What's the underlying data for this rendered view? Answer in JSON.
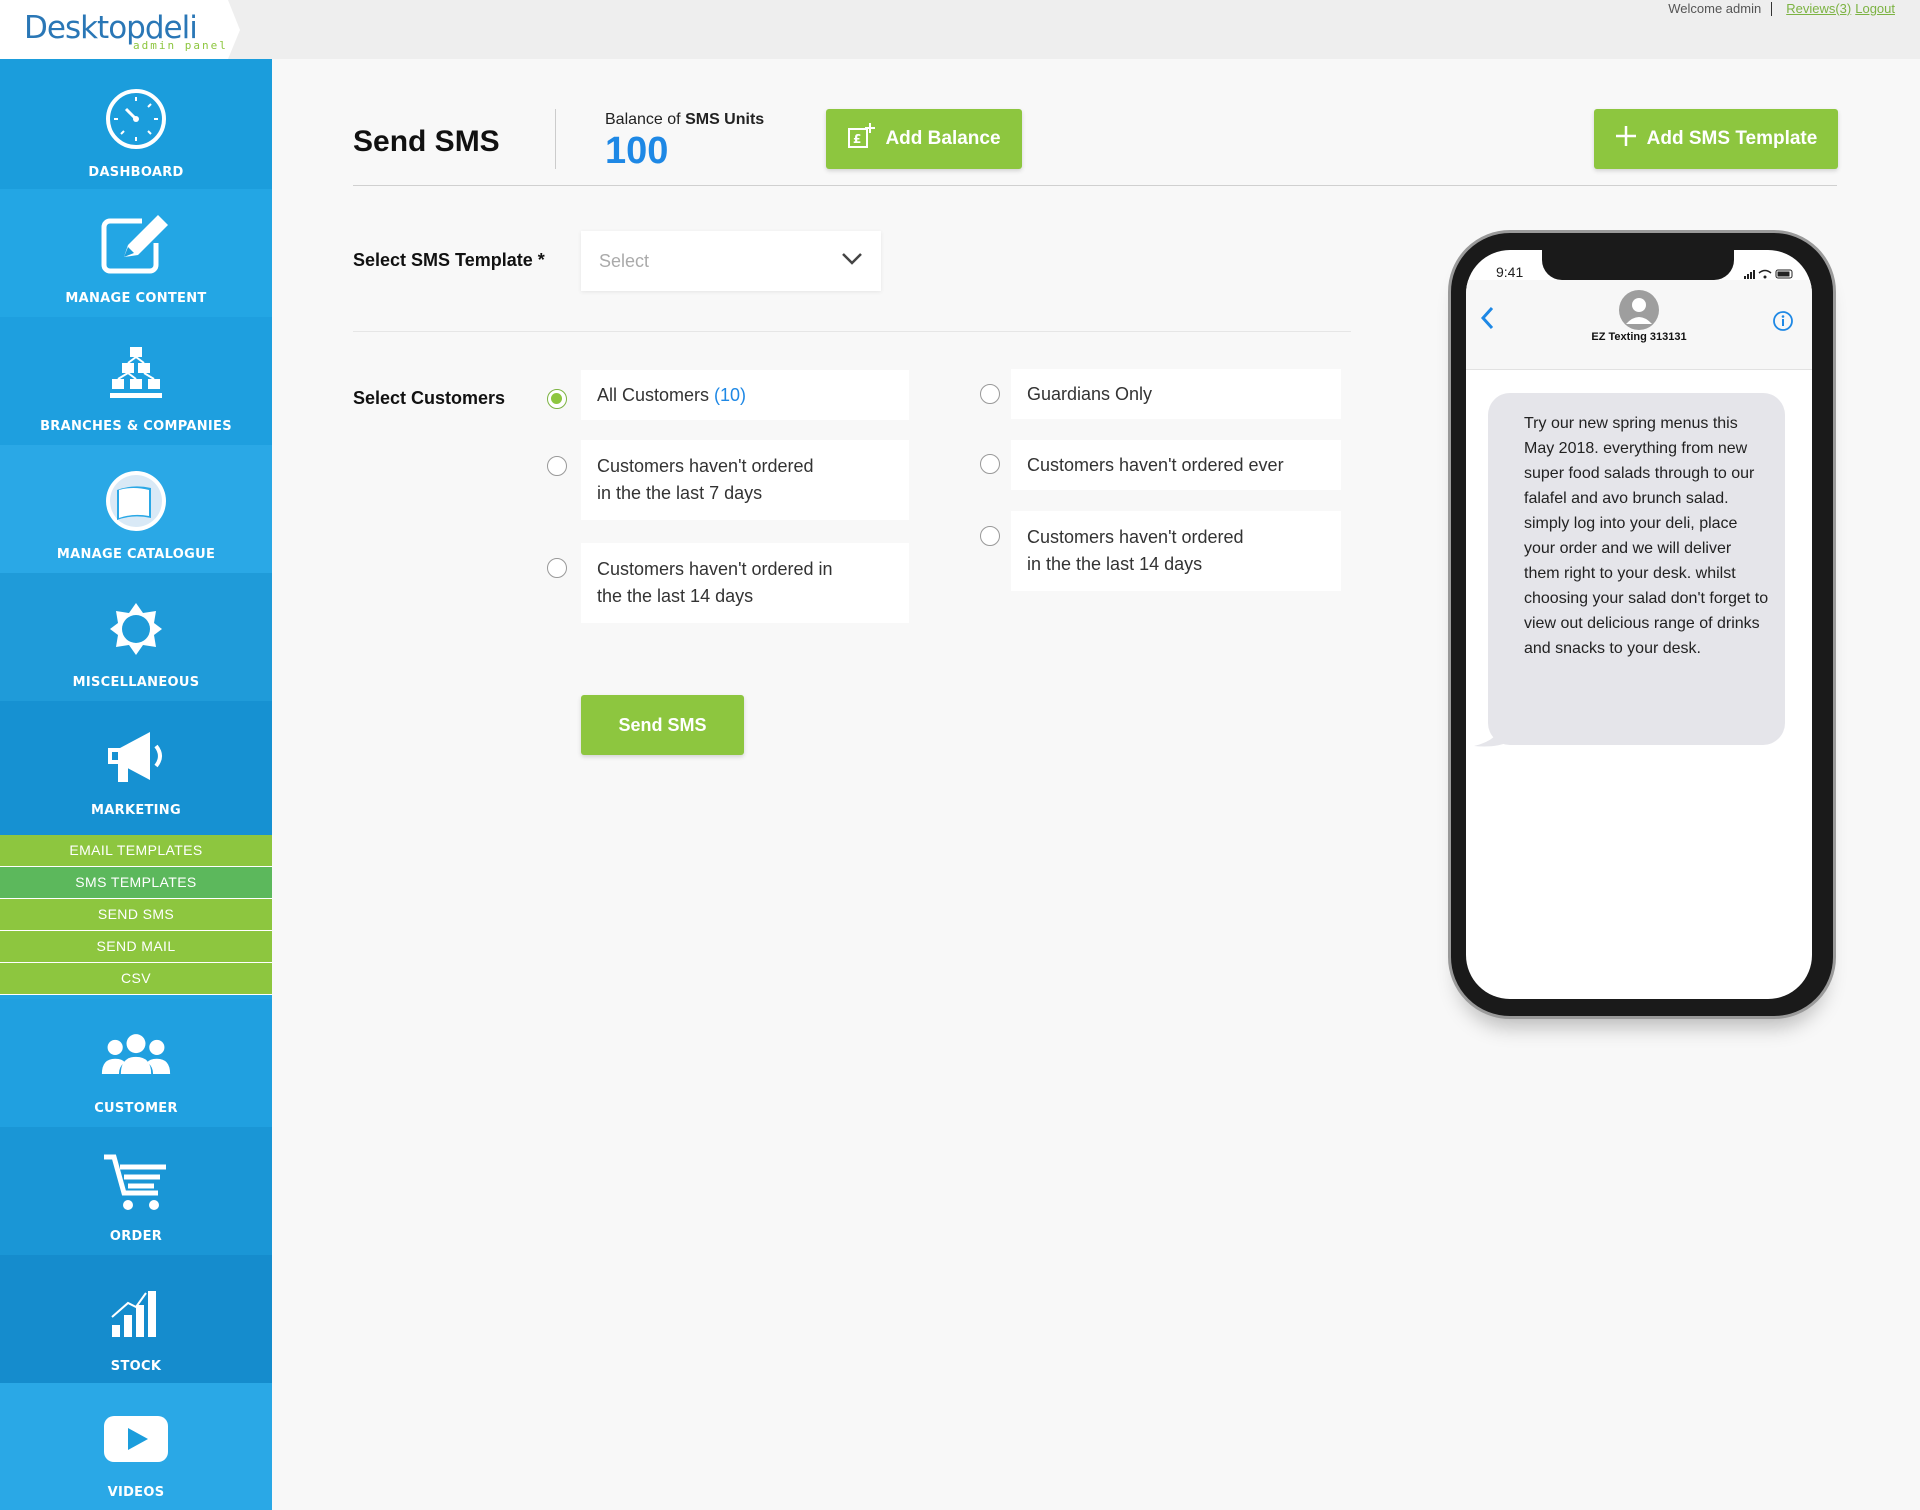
{
  "header": {
    "logo_text": "Desktopdeli",
    "logo_sub": "admin panel",
    "welcome": "Welcome admin",
    "reviews_link": "Reviews(3)",
    "logout_link": "Logout"
  },
  "sidebar": {
    "items": [
      {
        "label": "DASHBOARD",
        "icon": "dashboard-clock-icon"
      },
      {
        "label": "MANAGE CONTENT",
        "icon": "edit-icon"
      },
      {
        "label": "BRANCHES & COMPANIES",
        "icon": "hierarchy-icon"
      },
      {
        "label": "MANAGE CATALOGUE",
        "icon": "catalogue-book-icon"
      },
      {
        "label": "MISCELLANEOUS",
        "icon": "star-badge-icon"
      },
      {
        "label": "MARKETING",
        "icon": "megaphone-icon"
      },
      {
        "label": "CUSTOMER",
        "icon": "users-icon"
      },
      {
        "label": "ORDER",
        "icon": "cart-icon"
      },
      {
        "label": "STOCK",
        "icon": "bar-chart-icon"
      },
      {
        "label": "VIDEOS",
        "icon": "play-icon"
      }
    ],
    "marketing_sub": [
      "EMAIL TEMPLATES",
      "SMS TEMPLATES",
      "SEND SMS",
      "SEND MAIL",
      "CSV"
    ],
    "active_sub": "SMS TEMPLATES",
    "colors": {
      "base": "#22a3e2",
      "sub": "#8dc63f",
      "sub_active": "#5cb85c"
    }
  },
  "main": {
    "title": "Send SMS",
    "balance_prefix": "Balance of ",
    "balance_bold": "SMS Units",
    "balance_value": "100",
    "add_balance_label": "Add Balance",
    "add_template_label": "Add SMS Template",
    "template_label": "Select SMS Template *",
    "template_placeholder": "Select",
    "customers_label": "Select Customers",
    "options_left": [
      {
        "line1": "All Customers",
        "count": "(10)",
        "checked": true
      },
      {
        "line1": "Customers haven't ordered",
        "line2": "in the the last 7 days",
        "checked": false
      },
      {
        "line1": "Customers haven't ordered in",
        "line2": "the the last 14 days",
        "checked": false
      }
    ],
    "options_right": [
      {
        "line1": "Guardians Only",
        "checked": false
      },
      {
        "line1": "Customers haven't ordered ever",
        "checked": false
      },
      {
        "line1": "Customers haven't ordered",
        "line2": "in the the last 14 days",
        "checked": false
      }
    ],
    "send_label": "Send SMS",
    "accent": "#8dc63f",
    "link_blue": "#1e88e5"
  },
  "phone": {
    "time": "9:41",
    "contact": "EZ Texting 313131",
    "message": "Try our new spring menus this May 2018. everything from new super food salads through to our falafel and avo brunch salad. simply log into your deli, place your order and we will deliver them right to your desk. whilst choosing your salad don't forget to view out delicious range of drinks and snacks to your desk."
  }
}
